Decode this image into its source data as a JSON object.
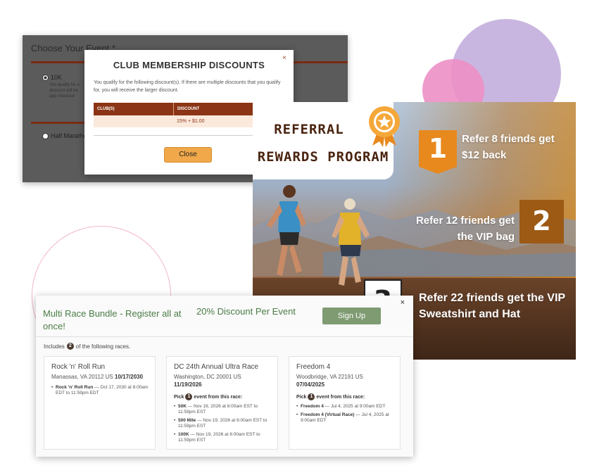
{
  "event_panel": {
    "title": "Choose Your Event *",
    "options": [
      {
        "label": "10K",
        "selected": true
      },
      {
        "label": "Half Marathon",
        "selected": false
      }
    ],
    "desc_fragment": "You qualify for a discount will be app checkout"
  },
  "discount_modal": {
    "close": "×",
    "title": "CLUB MEMBERSHIP DISCOUNTS",
    "text": "You qualify for the following discount(s). If there are multiple discounts that you qualify for, you will receive the larger discount.",
    "columns": [
      "CLUB(S)",
      "DISCOUNT"
    ],
    "rows": [
      {
        "club": "",
        "discount": "15% + $1.00"
      }
    ],
    "button": "Close"
  },
  "referral": {
    "title_line1": "REFERRAL",
    "title_line2": "REWARDS PROGRAM",
    "steps": [
      {
        "number": "1",
        "text": "Refer 8 friends get $12 back"
      },
      {
        "number": "2",
        "text": "Refer 12 friends get the VIP bag"
      },
      {
        "number": "3",
        "text": "Refer 22 friends get the VIP Sweatshirt and Hat"
      }
    ],
    "colors": {
      "accent": "#e8891e",
      "brown": "#9c5a14",
      "title": "#4a2410"
    }
  },
  "bundle": {
    "close": "×",
    "title": "Multi Race Bundle - Register all at once!",
    "discount": "20% Discount Per Event",
    "signup": "Sign Up",
    "includes_prefix": "Includes",
    "includes_count": "2",
    "includes_suffix": "of the following races.",
    "races": [
      {
        "name": "Rock 'n' Roll Run",
        "location": "Manassas, VA 20112 US",
        "date": "10/17/2030",
        "pick_count": "",
        "events": [
          {
            "name": "Rock 'n' Roll Run",
            "detail": " — Oct 17, 2030 at 8:00am EDT to 11:59pm EDT"
          }
        ]
      },
      {
        "name": "DC 24th Annual Ultra Race",
        "location": "Washington, DC 20001 US",
        "date": "11/19/2026",
        "pick_prefix": "Pick",
        "pick_count": "1",
        "pick_suffix": "event from this race:",
        "events": [
          {
            "name": "50K",
            "detail": " — Nov 19, 2026 at 6:00am EST to 11:59pm EST"
          },
          {
            "name": "500 Mile",
            "detail": " — Nov 19, 2026 at 6:00am EST to 11:59pm EST"
          },
          {
            "name": "100K",
            "detail": " — Nov 19, 2026 at 6:00am EST to 11:59pm EST"
          }
        ]
      },
      {
        "name": "Freedom 4",
        "location": "Woodbridge, VA 22191 US",
        "date": "07/04/2025",
        "pick_prefix": "Pick",
        "pick_count": "1",
        "pick_suffix": "event from this race:",
        "events": [
          {
            "name": "Freedom 4",
            "detail": " — Jul 4, 2025 at 9:00am EDT"
          },
          {
            "name": "Freedom 4 (Virtual Race)",
            "detail": " — Jul 4, 2025 at 9:00am EDT"
          }
        ]
      }
    ]
  }
}
